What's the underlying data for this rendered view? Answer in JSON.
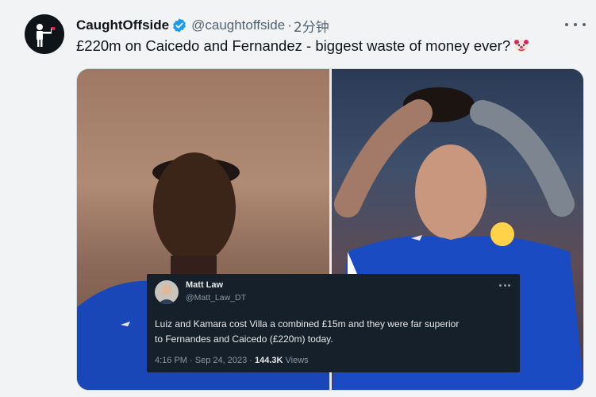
{
  "tweet": {
    "display_name": "CaughtOffside",
    "handle": "@caughtoffside",
    "separator": "·",
    "timestamp": "2分钟",
    "text": "£220m on Caicedo and Fernandez - biggest waste of money ever?",
    "emoji": "clown-face-icon",
    "verified_color": "#1d9bf0"
  },
  "media": {
    "embedded_tweet": {
      "name": "Matt Law",
      "handle": "@Matt_Law_DT",
      "text_line1": "Luiz and Kamara cost Villa a combined £15m and they were far superior",
      "text_line2": "to Fernandes and Caicedo (£220m) today.",
      "time": "4:16 PM · Sep 24, 2023 · ",
      "views_count": "144.3K",
      "views_label": " Views"
    }
  }
}
